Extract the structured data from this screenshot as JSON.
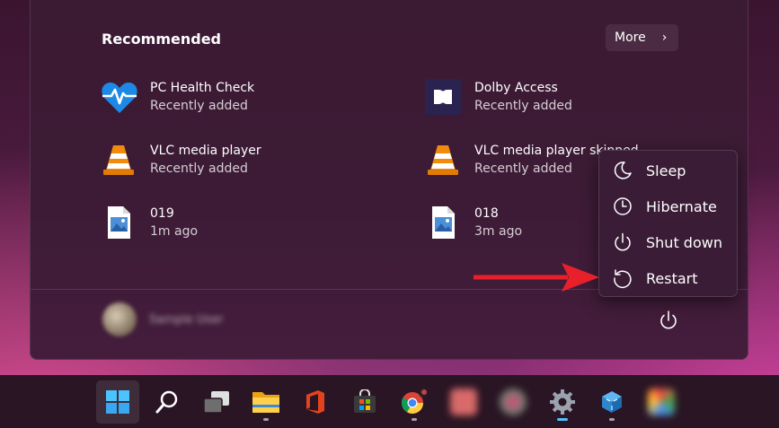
{
  "recommended": {
    "title": "Recommended",
    "more_label": "More",
    "items": [
      {
        "name": "PC Health Check",
        "sub": "Recently added"
      },
      {
        "name": "Dolby Access",
        "sub": "Recently added"
      },
      {
        "name": "VLC media player",
        "sub": "Recently added"
      },
      {
        "name": "VLC media player skinned",
        "sub": "Recently added"
      },
      {
        "name": "019",
        "sub": "1m ago"
      },
      {
        "name": "018",
        "sub": "3m ago"
      }
    ]
  },
  "power_menu": {
    "items": [
      {
        "label": "Sleep",
        "icon": "moon-icon"
      },
      {
        "label": "Hibernate",
        "icon": "clock-icon"
      },
      {
        "label": "Shut down",
        "icon": "power-icon"
      },
      {
        "label": "Restart",
        "icon": "restart-icon"
      }
    ]
  },
  "user": {
    "name": "Sample User"
  },
  "taskbar": {
    "icons": [
      "windows-start-icon",
      "search-icon",
      "task-view-icon",
      "file-explorer-icon",
      "office-icon",
      "store-icon",
      "chrome-icon",
      "app-blurred-1-icon",
      "app-blurred-2-icon",
      "settings-icon",
      "app-cube-icon",
      "app-blurred-3-icon"
    ]
  },
  "colors": {
    "accent": "#60b6ff",
    "arrow": "#e8202a"
  }
}
